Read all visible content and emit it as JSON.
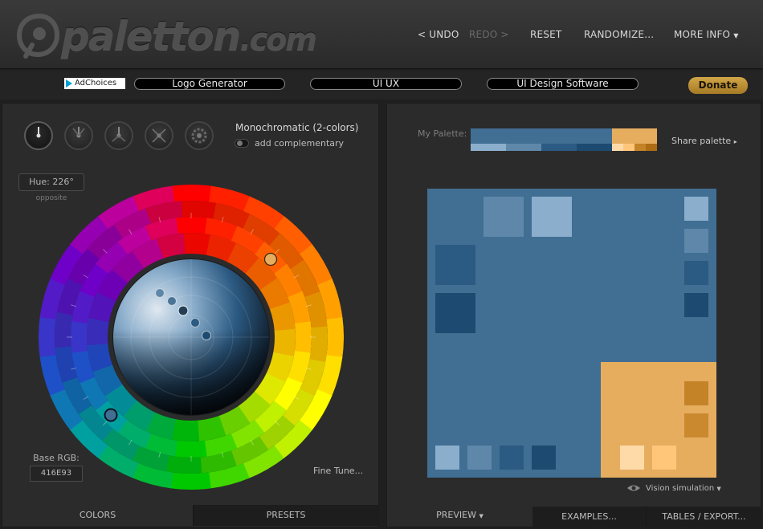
{
  "header": {
    "logo_text": "paletton",
    "logo_domain": ".com",
    "nav": {
      "undo": "< UNDO",
      "redo": "REDO >",
      "reset": "RESET",
      "randomize": "RANDOMIZE...",
      "more_info": "MORE INFO"
    }
  },
  "ads": {
    "adchoices": "AdChoices",
    "links": [
      "Logo Generator",
      "UI UX",
      "UI Design Software"
    ]
  },
  "donate_label": "Donate",
  "scheme": {
    "mode_title": "Monochromatic (2-colors)",
    "complement_toggle_label": "add complementary",
    "complement_on": false,
    "mode_icons": [
      "mono-icon",
      "adjacent-icon",
      "triad-icon",
      "tetrad-icon",
      "free-style-icon"
    ]
  },
  "hue": {
    "label": "Hue: 226°",
    "sub": "opposite"
  },
  "base_rgb": {
    "label": "Base RGB:",
    "value": "416E93"
  },
  "fine_tune_label": "Fine Tune...",
  "left_tabs": {
    "colors": "COLORS",
    "presets": "PRESETS"
  },
  "palette": {
    "label": "My Palette:",
    "share_label": "Share palette",
    "primary_colors": [
      "#416E93",
      "#8BAECC",
      "#5F87AA",
      "#2B5B82",
      "#1C4A70"
    ],
    "complement_colors": [
      "#E6AD5F",
      "#FFDAA9",
      "#FFC67A",
      "#C48327",
      "#AD6D14"
    ]
  },
  "vision_label": "Vision simulation",
  "right_tabs": {
    "preview": "PREVIEW",
    "examples": "EXAMPLES...",
    "tables": "TABLES / EXPORT..."
  },
  "colors": {
    "accent_gold": "#C79A3B",
    "panel_bg": "#2B2B2B",
    "header_bg": "#333333"
  }
}
